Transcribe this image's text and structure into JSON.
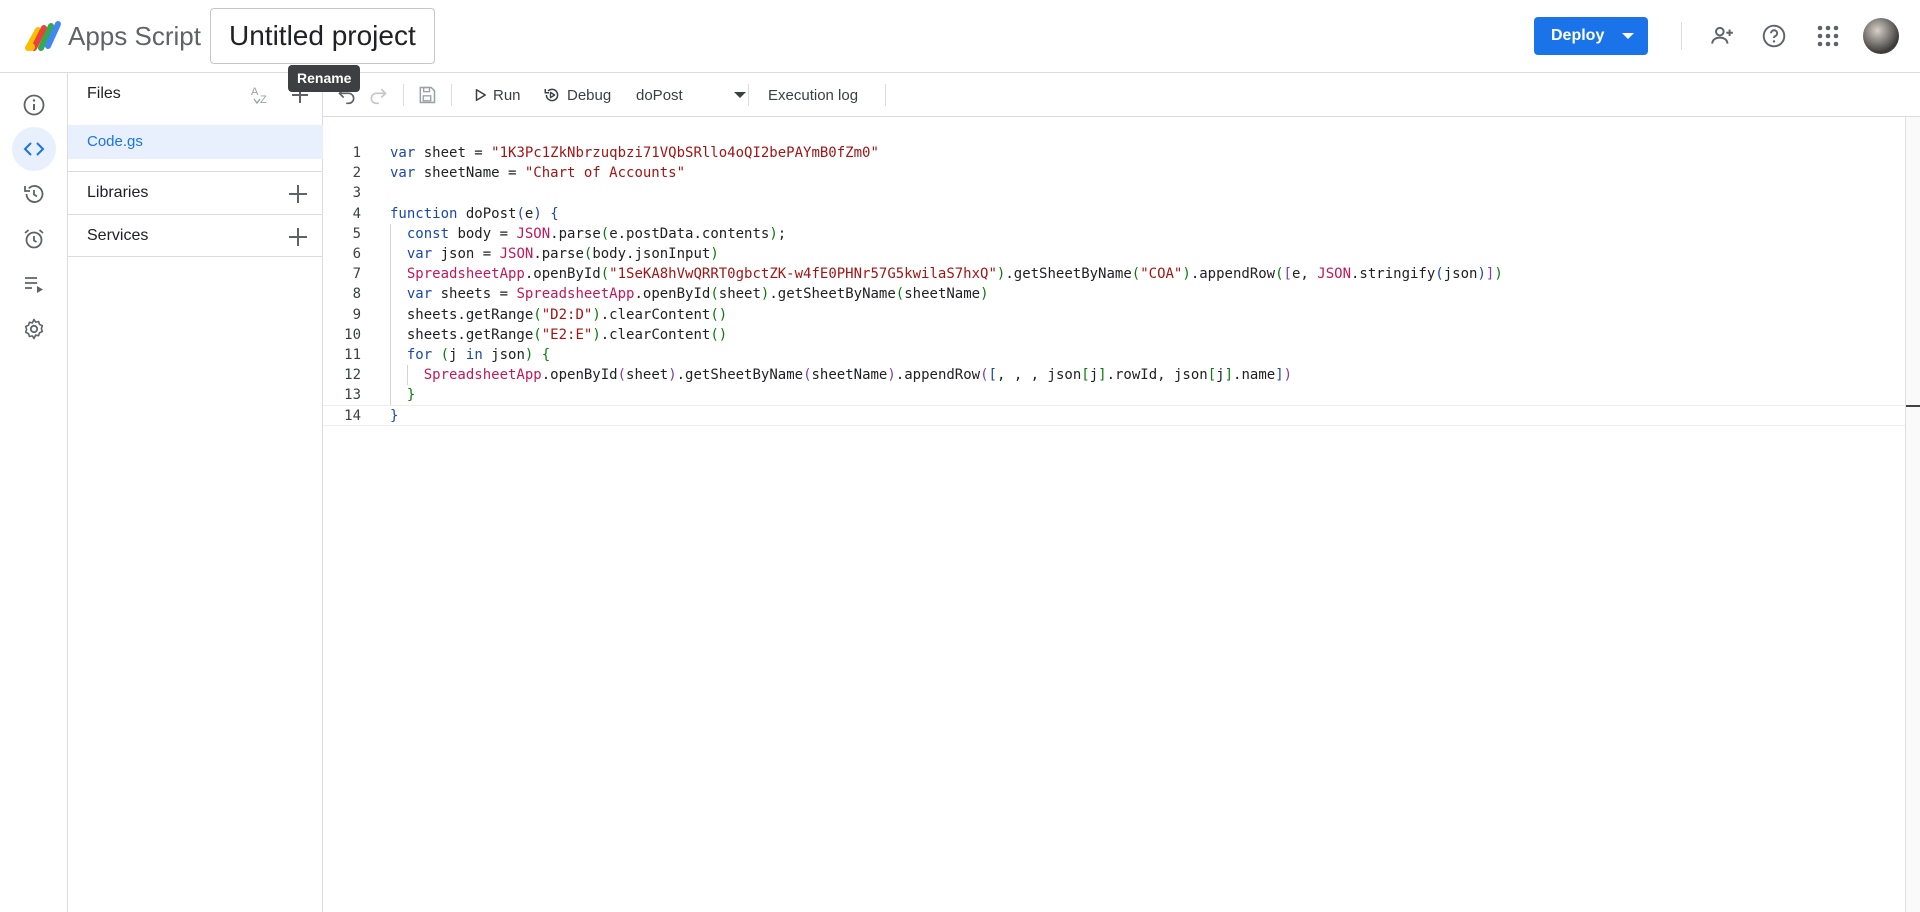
{
  "header": {
    "app_title": "Apps Script",
    "project_title": "Untitled project",
    "tooltip": "Rename",
    "deploy_label": "Deploy",
    "colors": {
      "accent": "#1a73e8"
    },
    "icons": [
      "person-add-icon",
      "help-icon",
      "apps-grid-icon",
      "avatar"
    ]
  },
  "rail": {
    "items": [
      {
        "name": "overview",
        "icon": "info-icon"
      },
      {
        "name": "editor",
        "icon": "code-icon",
        "active": true
      },
      {
        "name": "executions",
        "icon": "history-icon"
      },
      {
        "name": "triggers",
        "icon": "alarm-icon"
      },
      {
        "name": "logs",
        "icon": "playlist-play-icon"
      },
      {
        "name": "settings",
        "icon": "gear-icon"
      }
    ]
  },
  "files": {
    "title": "Files",
    "items": [
      {
        "name": "Code.gs"
      }
    ],
    "libraries_label": "Libraries",
    "services_label": "Services"
  },
  "toolbar": {
    "run_label": "Run",
    "debug_label": "Debug",
    "function_name": "doPost",
    "execution_log_label": "Execution log"
  },
  "editor": {
    "lines": [
      "var sheet = \"1K3Pc1ZkNbrzuqbzi71VQbSRllo4oQI2bePAYmB0fZm0\"",
      "var sheetName = \"Chart of Accounts\"",
      "",
      "function doPost(e) {",
      "  const body = JSON.parse(e.postData.contents);",
      "  var json = JSON.parse(body.jsonInput)",
      "  SpreadsheetApp.openById(\"1SeKA8hVwQRRT0gbctZK-w4fE0PHNr57G5kwilaS7hxQ\").getSheetByName(\"COA\").appendRow([e, JSON.stringify(json)])",
      "  var sheets = SpreadsheetApp.openById(sheet).getSheetByName(sheetName)",
      "  sheets.getRange(\"D2:D\").clearContent()",
      "  sheets.getRange(\"E2:E\").clearContent()",
      "  for (j in json) {",
      "    SpreadsheetApp.openById(sheet).getSheetByName(sheetName).appendRow([, , , json[j].rowId, json[j].name])",
      "  }",
      "}"
    ]
  }
}
